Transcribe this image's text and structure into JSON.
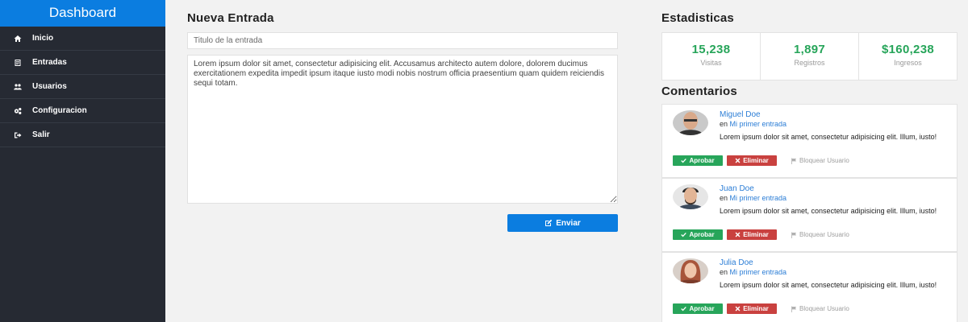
{
  "sidebar": {
    "brand": "Dashboard",
    "items": [
      {
        "label": "Inicio",
        "icon": "home-icon"
      },
      {
        "label": "Entradas",
        "icon": "entries-icon"
      },
      {
        "label": "Usuarios",
        "icon": "users-icon"
      },
      {
        "label": "Configuracion",
        "icon": "cogs-icon"
      },
      {
        "label": "Salir",
        "icon": "sign-out-icon"
      }
    ]
  },
  "entry": {
    "heading": "Nueva Entrada",
    "title_placeholder": "Titulo de la entrada",
    "body_value": "Lorem ipsum dolor sit amet, consectetur adipisicing elit. Accusamus architecto autem dolore, dolorem ducimus exercitationem expedita impedit ipsum itaque iusto modi nobis nostrum officia praesentium quam quidem reiciendis sequi totam.",
    "send_label": "Enviar"
  },
  "stats": {
    "heading": "Estadisticas",
    "items": [
      {
        "value": "15,238",
        "label": "Visitas"
      },
      {
        "value": "1,897",
        "label": "Registros"
      },
      {
        "value": "$160,238",
        "label": "Ingresos"
      }
    ]
  },
  "comments": {
    "heading": "Comentarios",
    "items": [
      {
        "name": "Miguel Doe",
        "meta_prefix": "en",
        "post": "Mi primer entrada",
        "body": "Lorem ipsum dolor sit amet, consectetur adipisicing elit. Illum, iusto!",
        "approve": "Aprobar",
        "delete": "Eliminar",
        "block": "Bloquear Usuario"
      },
      {
        "name": "Juan Doe",
        "meta_prefix": "en",
        "post": "Mi primer entrada",
        "body": "Lorem ipsum dolor sit amet, consectetur adipisicing elit. Illum, iusto!",
        "approve": "Aprobar",
        "delete": "Eliminar",
        "block": "Bloquear Usuario"
      },
      {
        "name": "Julia Doe",
        "meta_prefix": "en",
        "post": "Mi primer entrada",
        "body": "Lorem ipsum dolor sit amet, consectetur adipisicing elit. Illum, iusto!",
        "approve": "Aprobar",
        "delete": "Eliminar",
        "block": "Bloquear Usuario"
      }
    ]
  },
  "colors": {
    "brand_blue": "#0b7de0",
    "sidebar_bg": "#262a33",
    "success_green": "#27a55a",
    "danger_red": "#c9413f",
    "link_blue": "#2c7ed6"
  }
}
